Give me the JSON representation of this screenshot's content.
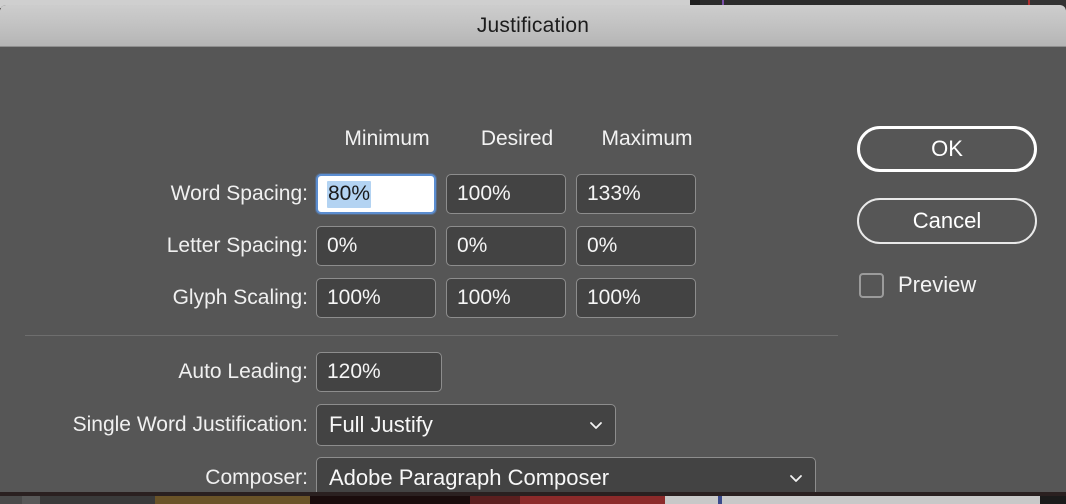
{
  "window": {
    "title": "Justification"
  },
  "grid": {
    "column_headers": [
      "Minimum",
      "Desired",
      "Maximum"
    ],
    "rows": [
      {
        "label": "Word Spacing:",
        "values": [
          "80%",
          "100%",
          "133%"
        ],
        "focused_index": 0,
        "selected_text": "80%"
      },
      {
        "label": "Letter Spacing:",
        "values": [
          "0%",
          "0%",
          "0%"
        ],
        "focused_index": -1
      },
      {
        "label": "Glyph Scaling:",
        "values": [
          "100%",
          "100%",
          "100%"
        ],
        "focused_index": -1
      }
    ]
  },
  "options": {
    "auto_leading": {
      "label": "Auto Leading:",
      "value": "120%"
    },
    "single_word_justification": {
      "label": "Single Word Justification:",
      "value": "Full Justify",
      "icon": "chevron-down-icon"
    },
    "composer": {
      "label": "Composer:",
      "value": "Adobe Paragraph Composer",
      "icon": "chevron-down-icon"
    }
  },
  "actions": {
    "ok_label": "OK",
    "cancel_label": "Cancel",
    "preview_label": "Preview",
    "preview_checked": false
  },
  "colors": {
    "dialog_background": "#565656",
    "titlebar": "#c2c2c2",
    "field_background": "#434343",
    "field_border": "#8d8d8d",
    "focus_border": "#5b8dd0",
    "selection": "#b3d3f2",
    "text": "#f2f2f2"
  }
}
